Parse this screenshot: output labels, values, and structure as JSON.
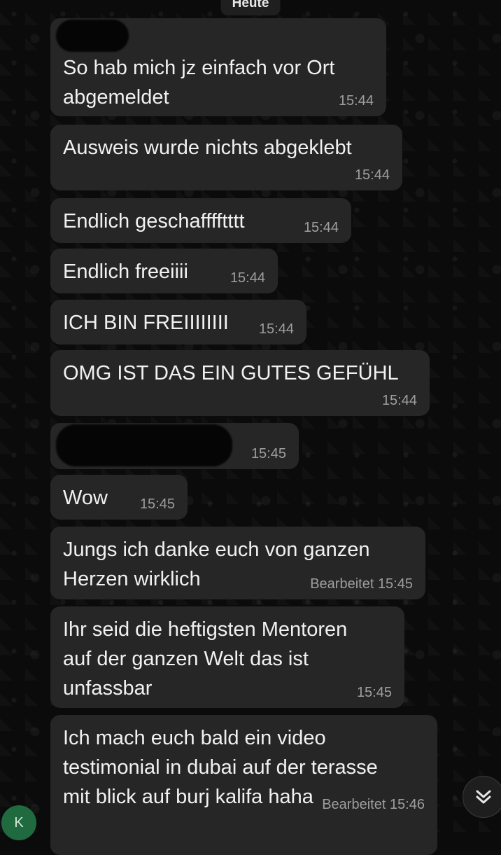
{
  "header": {
    "date_label": "Heute"
  },
  "messages": [
    {
      "text": "So hab mich jz einfach vor Ort\nabgemeldet",
      "time": "15:44",
      "edited": ""
    },
    {
      "text": "Ausweis wurde nichts abgeklebt",
      "time": "15:44",
      "edited": ""
    },
    {
      "text": "Endlich geschafffftttt",
      "time": "15:44",
      "edited": ""
    },
    {
      "text": "Endlich freeiiii",
      "time": "15:44",
      "edited": ""
    },
    {
      "text": "ICH BIN FREIIIIIIII",
      "time": "15:44",
      "edited": ""
    },
    {
      "text": "OMG IST DAS EIN GUTES GEFÜHL",
      "time": "15:44",
      "edited": ""
    },
    {
      "text": "",
      "time": "15:45",
      "edited": ""
    },
    {
      "text": "Wow",
      "time": "15:45",
      "edited": ""
    },
    {
      "text": "Jungs ich danke euch von ganzen\nHerzen wirklich",
      "time": "15:45",
      "edited": "Bearbeitet"
    },
    {
      "text": "Ihr seid die heftigsten Mentoren\nauf der ganzen Welt das ist\nunfassbar",
      "time": "15:45",
      "edited": ""
    },
    {
      "text": "Ich mach euch bald ein video\ntestimonial in dubai auf der terasse\nmit blick auf burj kalifa haha",
      "time": "15:46",
      "edited": "Bearbeitet"
    }
  ],
  "avatar": {
    "initial": "K",
    "color": "#1f6b3f"
  },
  "scroll_button": {
    "icon": "double-chevron-down-icon"
  },
  "colors": {
    "background": "#0b0b0b",
    "bubble": "#262626",
    "meta_text": "#9e9e9e"
  }
}
